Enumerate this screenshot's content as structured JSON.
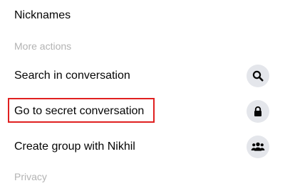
{
  "menu": {
    "nicknames_label": "Nicknames",
    "more_actions_label": "More actions",
    "search_label": "Search in conversation",
    "search_icon": "search-icon",
    "secret_label": "Go to secret conversation",
    "secret_icon": "lock-icon",
    "group_label": "Create group with Nikhil",
    "group_icon": "group-icon",
    "privacy_label": "Privacy"
  },
  "colors": {
    "text": "#050505",
    "section_text": "#b3b3b3",
    "icon_bg": "#e4e6eb",
    "highlight": "#e02020"
  }
}
